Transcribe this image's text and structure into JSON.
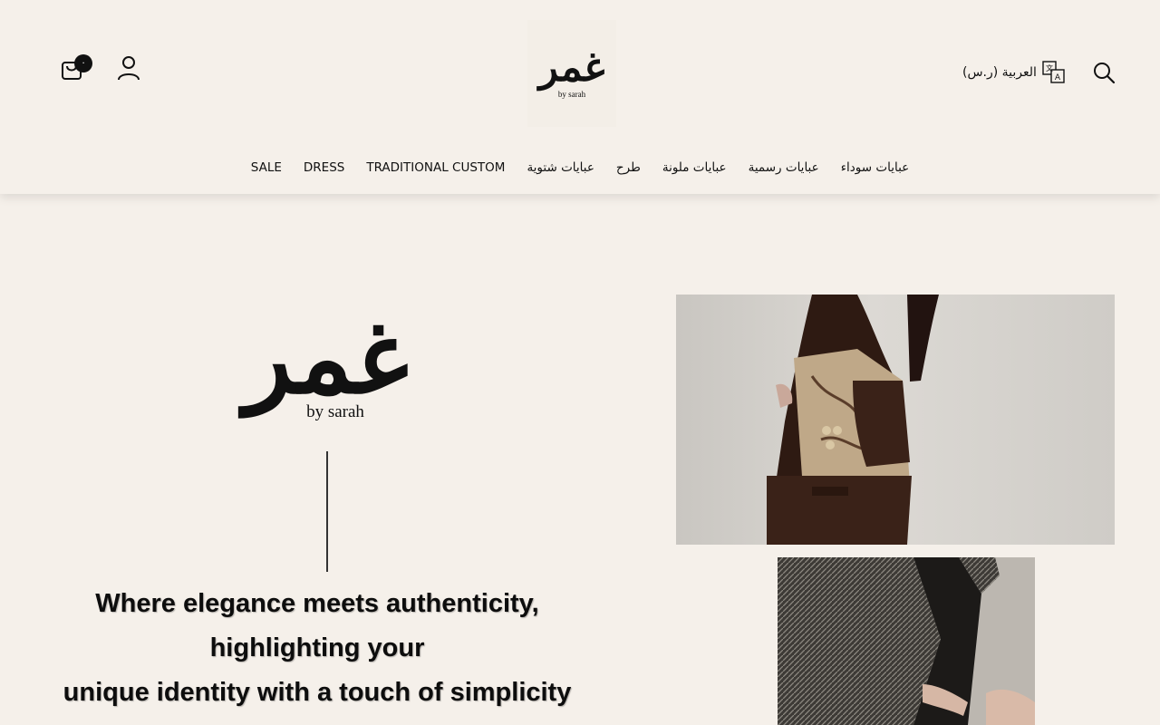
{
  "header": {
    "logo": {
      "arabic": "غمر",
      "sub": "by sarah"
    },
    "language_label": "العربية (ر.س)",
    "cart_count": "٠",
    "icons": {
      "search": "search-icon",
      "language": "translate-icon",
      "account": "user-icon",
      "cart": "shopping-bag-icon"
    }
  },
  "nav": {
    "items": [
      {
        "label": "عبايات سوداء"
      },
      {
        "label": "عبايات رسمية"
      },
      {
        "label": "عبايات ملونة"
      },
      {
        "label": "طرح"
      },
      {
        "label": "عبايات شتوية"
      },
      {
        "label": "TRADITIONAL CUSTOM"
      },
      {
        "label": "DRESS"
      },
      {
        "label": "SALE"
      }
    ]
  },
  "hero": {
    "brand_arabic": "غمر",
    "brand_sub": "by sarah",
    "tagline_line1": "Where elegance meets authenticity, highlighting your",
    "tagline_line2": "unique identity with a touch of simplicity"
  },
  "colors": {
    "background": "#f5f0ea",
    "text": "#111111",
    "badge": "#111111"
  }
}
